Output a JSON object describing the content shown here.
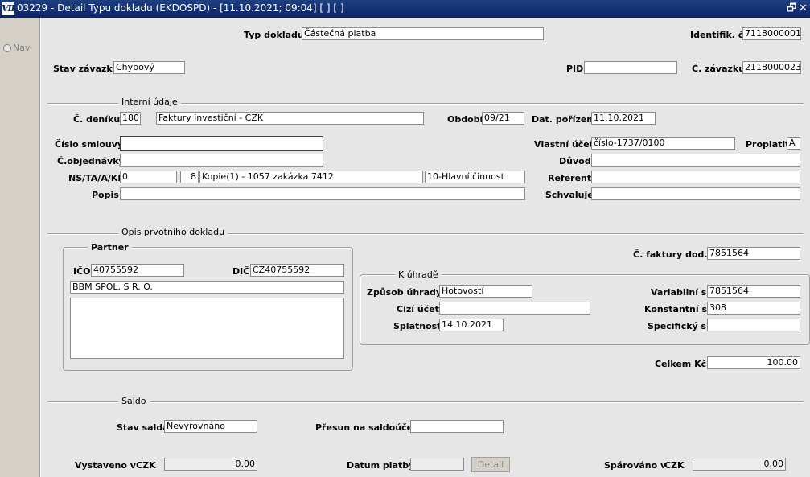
{
  "window": {
    "title": "03229 - Detail Typu dokladu (EKDOSPD) - [11.10.2021; 09:04]  [ ]  [ ]",
    "app_icon": "Ⅶ",
    "restore_glyph": "🗗",
    "close_glyph": "✕"
  },
  "sidebar": {
    "nav_label": "Nav"
  },
  "header": {
    "typ_dokladu_label": "Typ dokladu",
    "typ_dokladu_value": "Částečná platba",
    "identifik_label": "Identifik. č.",
    "identifik_value": "7118000001",
    "stav_zavazku_label": "Stav závazku",
    "stav_zavazku_value": "Chybový",
    "pid_label": "PID",
    "pid_value": "",
    "c_zavazku_label": "Č. závazku",
    "c_zavazku_value": "2118000023"
  },
  "interni": {
    "section_title": "Interní údaje",
    "c_deniku_label": "Č. deníku",
    "c_deniku_value": "180",
    "denik_name": "Faktury investiční - CZK",
    "obdobi_label": "Období",
    "obdobi_value": "09/21",
    "dat_porizeni_label": "Dat. pořízení",
    "dat_porizeni_value": "11.10.2021",
    "cislo_smlouvy_label": "Číslo smlouvy",
    "cislo_smlouvy_value": "",
    "vlastni_ucet_label": "Vlastní účet",
    "vlastni_ucet_value": "číslo-1737/0100",
    "proplatit_label": "Proplatit",
    "proplatit_value": "A",
    "c_objednavky_label": "Č.objednávky",
    "c_objednavky_value": "",
    "duvod_label": "Důvod",
    "duvod_value": "",
    "ns_label": "NS/TA/A/KP",
    "ns_value": "0",
    "ta_value": "8",
    "a_value": "Kopie(1) - 1057 zakázka 7412",
    "kp_value": "10-Hlavní činnost",
    "referent_label": "Referent",
    "referent_value": "",
    "popis_label": "Popis",
    "popis_value": "",
    "schvaluje_label": "Schvaluje",
    "schvaluje_value": ""
  },
  "opis": {
    "section_title": "Opis prvotního dokladu",
    "partner_title": "Partner",
    "ico_label": "IČO",
    "ico_value": "40755592",
    "dic_label": "DIČ",
    "dic_value": "CZ40755592",
    "partner_name": "BBM SPOL. S R. O.",
    "partner_address": "",
    "c_faktury_label": "Č. faktury  dod.",
    "c_faktury_value": "7851564",
    "k_uhrade_title": "K úhradě",
    "zpusob_label": "Způsob úhrady",
    "zpusob_value": "Hotovostí",
    "cizi_ucet_label": "Cizí účet",
    "cizi_ucet_value": "",
    "splatnost_label": "Splatnost",
    "splatnost_value": "14.10.2021",
    "variabilni_label": "Variabilní s.",
    "variabilni_value": "7851564",
    "konstantni_label": "Konstantní s.",
    "konstantni_value": "308",
    "specificky_label": "Specifický s.",
    "specificky_value": "",
    "celkem_label": "Celkem Kč",
    "celkem_value": "100.00"
  },
  "saldo": {
    "section_title": "Saldo",
    "stav_salda_label": "Stav salda",
    "stav_salda_value": "Nevyrovnáno",
    "presun_label": "Přesun na saldoúčet",
    "presun_value": "",
    "vystaveno_label": "Vystaveno v",
    "vystaveno_currency": "CZK",
    "vystaveno_value": "0.00",
    "datum_platby_label": "Datum platby",
    "datum_platby_value": "",
    "detail_button": "Detail",
    "sparovano_label": "Spárováno v",
    "sparovano_currency": "CZK",
    "sparovano_value": "0.00"
  }
}
